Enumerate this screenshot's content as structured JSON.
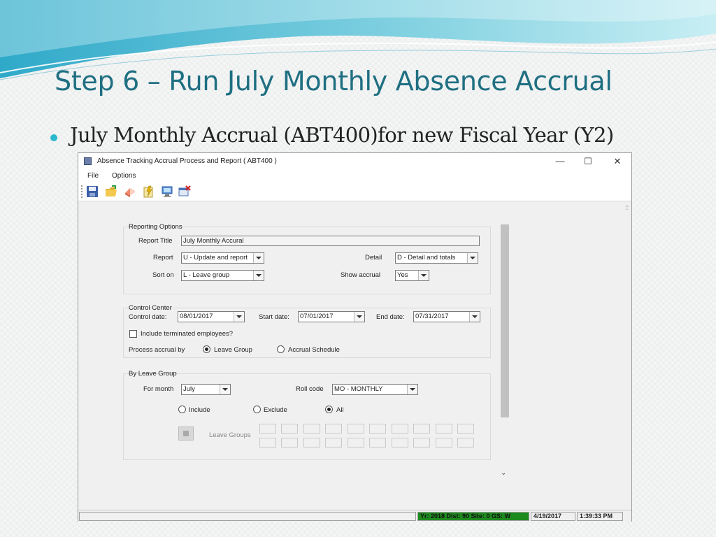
{
  "slide": {
    "title": "Step 6 – Run July Monthly Absence Accrual",
    "bullet": "July Monthly Accrual (ABT400)for new Fiscal Year (Y2)"
  },
  "colors": {
    "title": "#1f6f82",
    "bullet": "#2bb8cf",
    "status_green": "#1e8a1e"
  },
  "window": {
    "title": "Absence Tracking Accrual Process and Report ( ABT400 )",
    "controls": {
      "minimize": "—",
      "maximize": "☐",
      "close": "✕"
    },
    "menu": [
      "File",
      "Options"
    ],
    "toolbar_icons": [
      "save-icon",
      "open-folder-icon",
      "eraser-icon",
      "run-process-icon",
      "monitor-icon",
      "close-window-icon"
    ]
  },
  "reporting_options": {
    "label": "Reporting Options",
    "report_title_label": "Report Title",
    "report_title_value": "July Monthly Accural",
    "report_label": "Report",
    "report_value": "U - Update and report",
    "detail_label": "Detail",
    "detail_value": "D - Detail and totals",
    "sort_label": "Sort on",
    "sort_value": "L - Leave group",
    "show_accrual_label": "Show accrual",
    "show_accrual_value": "Yes"
  },
  "control_center": {
    "label": "Control Center",
    "control_date_label": "Control date:",
    "control_date": "08/01/2017",
    "start_date_label": "Start date:",
    "start_date": "07/01/2017",
    "end_date_label": "End date:",
    "end_date": "07/31/2017",
    "include_terminated_label": "Include terminated employees?",
    "include_terminated_checked": false,
    "process_by_label": "Process accrual by",
    "option_leave_group": "Leave Group",
    "option_accrual_schedule": "Accrual Schedule",
    "selected": "Leave Group"
  },
  "by_leave_group": {
    "label": "By Leave Group",
    "for_month_label": "For month",
    "for_month_value": "July",
    "roll_code_label": "Roll code",
    "roll_code_value": "MO - MONTHLY",
    "include_label": "Include",
    "exclude_label": "Exclude",
    "all_label": "All",
    "selected": "All",
    "leave_groups_label": "Leave Groups"
  },
  "statusbar": {
    "info": "Yr: 2018 Dist: 90 Site: 0 GS: W",
    "date": "4/19/2017",
    "time": "1:39:33 PM"
  }
}
